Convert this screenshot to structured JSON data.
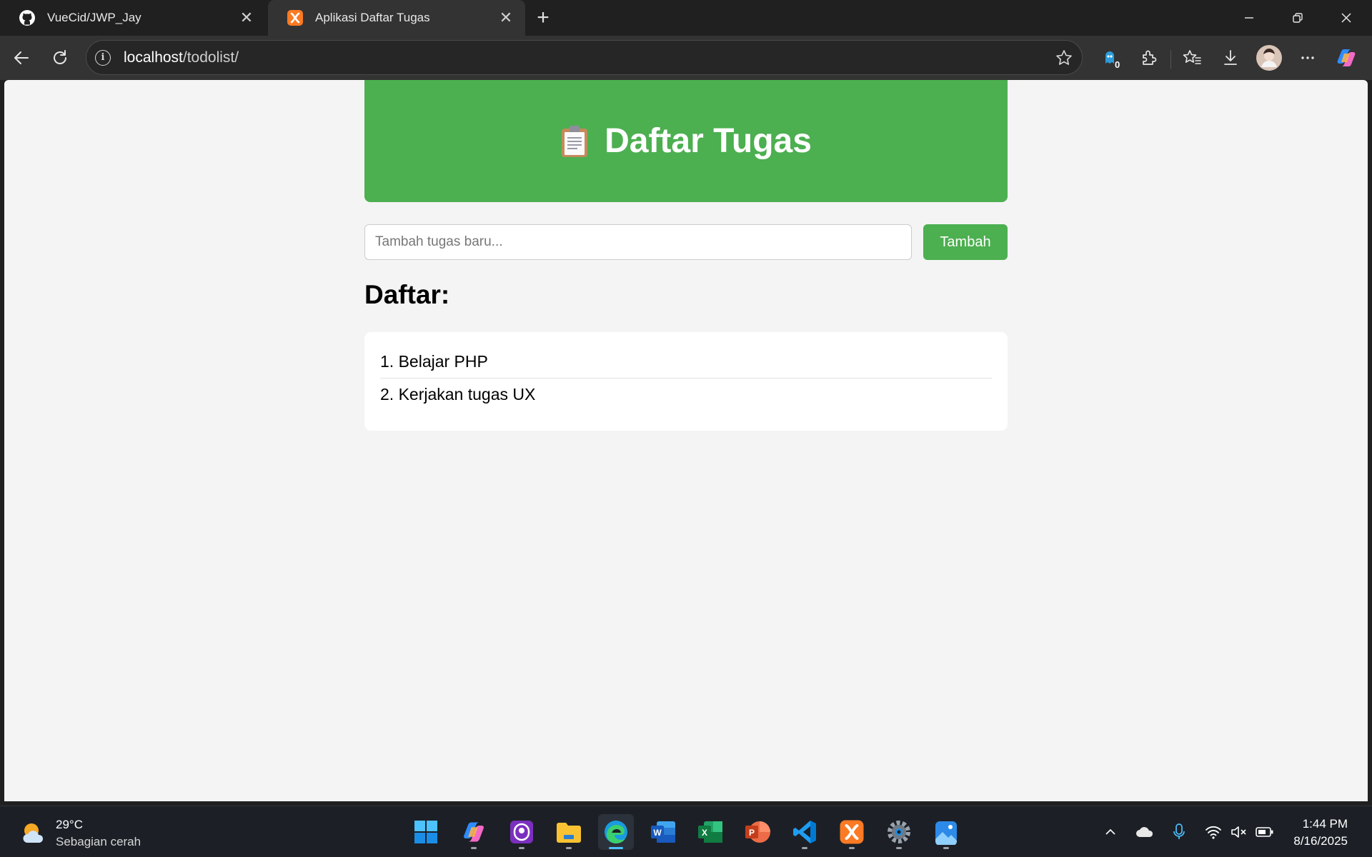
{
  "browser": {
    "tabs": [
      {
        "title": "VueCid/JWP_Jay",
        "icon": "github-icon",
        "active": false
      },
      {
        "title": "Aplikasi Daftar Tugas",
        "icon": "xampp-icon",
        "active": true
      }
    ],
    "address": {
      "host": "localhost",
      "path": "/todolist/"
    },
    "extension_badge": "0"
  },
  "page": {
    "title": "Daftar Tugas",
    "title_icon": "clipboard-icon",
    "input_placeholder": "Tambah tugas baru...",
    "add_button": "Tambah",
    "list_heading": "Daftar:",
    "tasks": [
      "1. Belajar PHP",
      "2. Kerjakan tugas UX"
    ],
    "accent_color": "#4caf50"
  },
  "taskbar": {
    "weather": {
      "temp": "29°C",
      "desc": "Sebagian cerah"
    },
    "apps": [
      "start",
      "copilot",
      "launcher",
      "file-explorer",
      "edge",
      "word",
      "excel",
      "powerpoint",
      "vscode",
      "xampp",
      "settings",
      "photos"
    ],
    "active_app": "edge",
    "time": "1:44 PM",
    "date": "8/16/2025"
  }
}
